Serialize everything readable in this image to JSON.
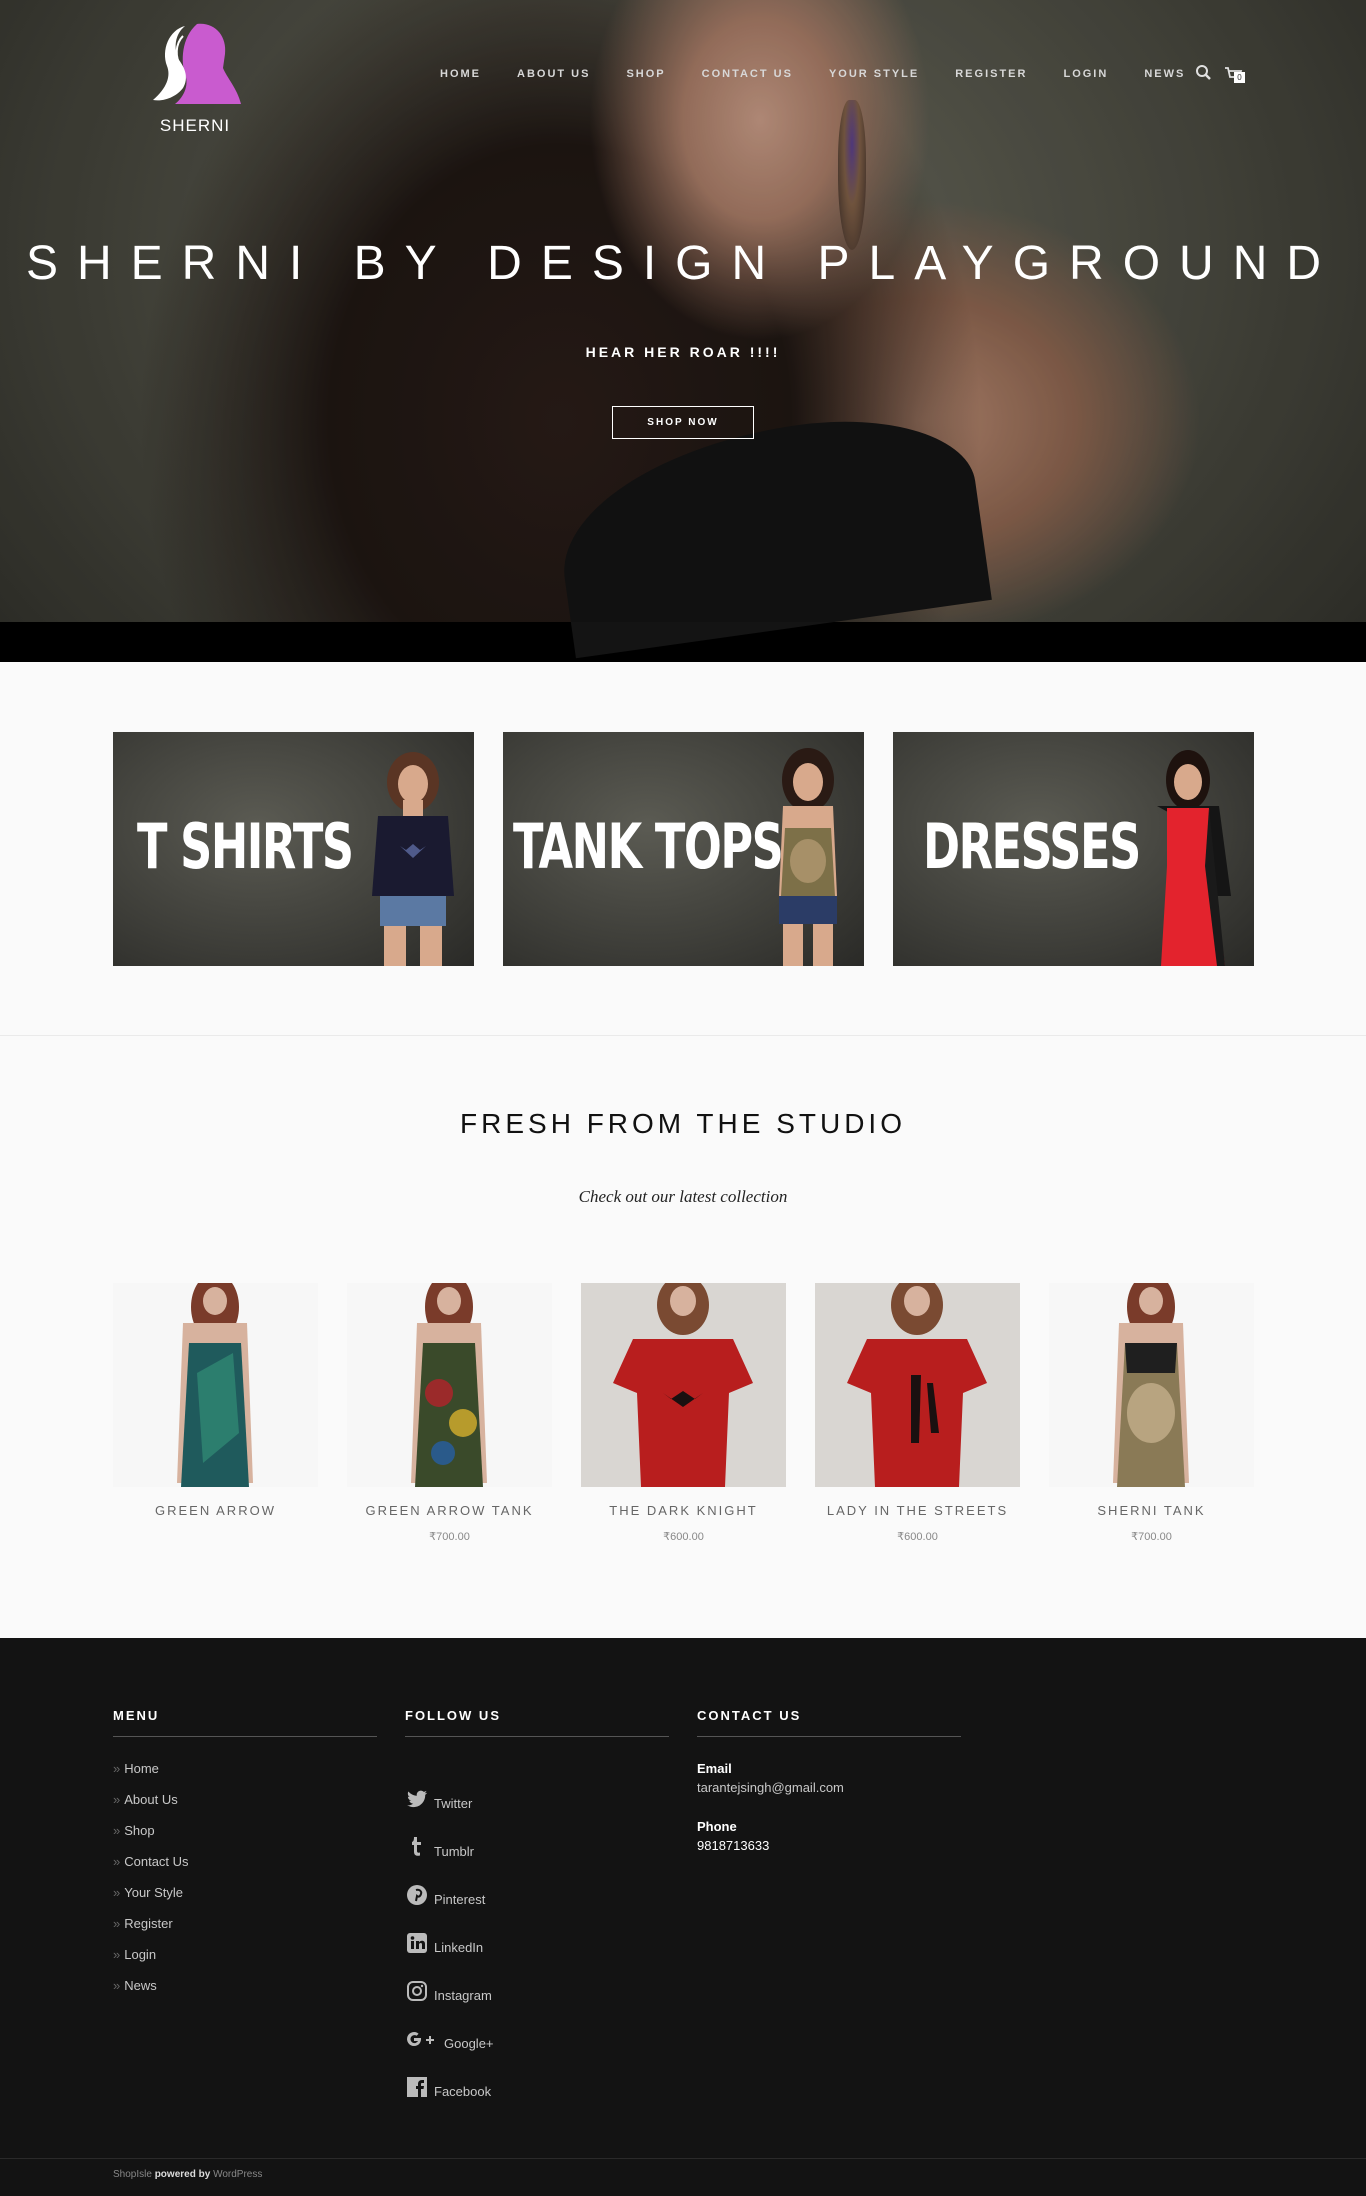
{
  "brand": {
    "name": "SHERNI",
    "logo_colors": {
      "face": "#c95bcf",
      "outline": "#ffffff"
    }
  },
  "nav": {
    "items": [
      "HOME",
      "ABOUT US",
      "SHOP",
      "CONTACT US",
      "YOUR STYLE",
      "REGISTER",
      "LOGIN",
      "NEWS"
    ],
    "cart_count": "0",
    "icons": [
      "search-icon",
      "cart-icon"
    ]
  },
  "hero": {
    "title": "SHERNI BY DESIGN PLAYGROUND",
    "subtitle": "HEAR HER ROAR !!!!",
    "button_label": "SHOP NOW"
  },
  "categories": [
    {
      "label": "T SHIRTS",
      "garment_color": "#1a1a30"
    },
    {
      "label": "TANK TOPS",
      "garment_color": "#7d7048"
    },
    {
      "label": "DRESSES",
      "garment_color": "#e3232d"
    }
  ],
  "studio": {
    "title": "FRESH FROM THE STUDIO",
    "subtitle": "Check out our latest collection"
  },
  "products": [
    {
      "name": "GREEN ARROW",
      "price": "",
      "style": "tank",
      "color": "#1f5a5c"
    },
    {
      "name": "GREEN ARROW TANK",
      "price": "₹700.00",
      "style": "tank",
      "color": "#3a4a2a"
    },
    {
      "name": "THE DARK KNIGHT",
      "price": "₹600.00",
      "style": "tee",
      "color": "#b81e1e"
    },
    {
      "name": "LADY IN THE STREETS",
      "price": "₹600.00",
      "style": "tee",
      "color": "#b81e1e"
    },
    {
      "name": "SHERNI TANK",
      "price": "₹700.00",
      "style": "tank",
      "color": "#8a7a56"
    }
  ],
  "footer": {
    "menu_title": "MENU",
    "menu_items": [
      "Home",
      "About Us",
      "Shop",
      "Contact Us",
      "Your Style",
      "Register",
      "Login",
      "News"
    ],
    "follow_title": "FOLLOW US",
    "social": [
      {
        "label": "Twitter",
        "icon": "twitter-icon"
      },
      {
        "label": "Tumblr",
        "icon": "tumblr-icon"
      },
      {
        "label": "Pinterest",
        "icon": "pinterest-icon"
      },
      {
        "label": "LinkedIn",
        "icon": "linkedin-icon"
      },
      {
        "label": "Instagram",
        "icon": "instagram-icon"
      },
      {
        "label": "Google+",
        "icon": "google-plus-icon"
      },
      {
        "label": "Facebook",
        "icon": "facebook-icon"
      }
    ],
    "contact_title": "CONTACT US",
    "email_label": "Email",
    "email": "tarantejsingh@gmail.com",
    "phone_label": "Phone",
    "phone": "9818713633",
    "credit_theme": "ShopIsle",
    "credit_powered": "powered by",
    "credit_platform": "WordPress"
  }
}
